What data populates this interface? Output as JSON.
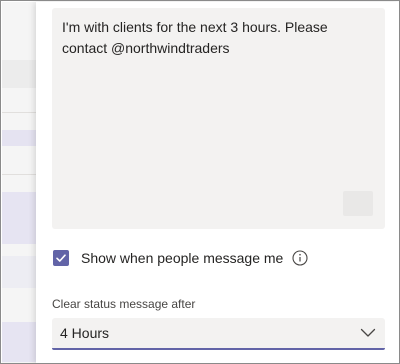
{
  "status_message": {
    "text": "I'm with clients for the next 3 hours. Please contact @northwindtraders"
  },
  "show_when_message": {
    "label": "Show when people message me",
    "checked": true
  },
  "clear_after": {
    "label": "Clear status message after",
    "selected": "4 Hours"
  },
  "icons": {
    "check": "checkmark-icon",
    "info": "info-icon",
    "emoji": "emoji-icon",
    "dropdown": "chevron-down-icon"
  },
  "colors": {
    "accent": "#6264a7",
    "field_bg": "#f3f2f1"
  }
}
